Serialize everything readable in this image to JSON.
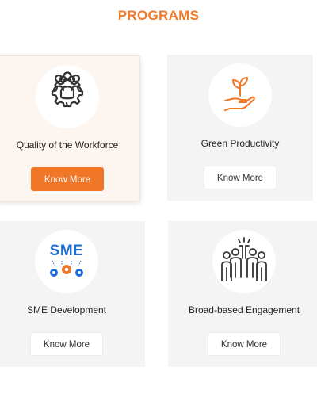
{
  "header": {
    "title": "PROGRAMS"
  },
  "programs": [
    {
      "title": "Quality of the Workforce",
      "button_label": "Know More",
      "icon": "team-gear-icon"
    },
    {
      "title": "Green Productivity",
      "button_label": "Know More",
      "icon": "plant-hand-icon"
    },
    {
      "title": "SME Development",
      "button_label": "Know More",
      "icon": "sme-gears-icon",
      "icon_text": "SME"
    },
    {
      "title": "Broad-based Engagement",
      "button_label": "Know More",
      "icon": "raised-hands-icon"
    }
  ],
  "colors": {
    "accent": "#f07628",
    "card_bg": "#f4f4f4",
    "active_card_bg": "#fdf5ef",
    "sme_blue": "#1f6ed4"
  }
}
